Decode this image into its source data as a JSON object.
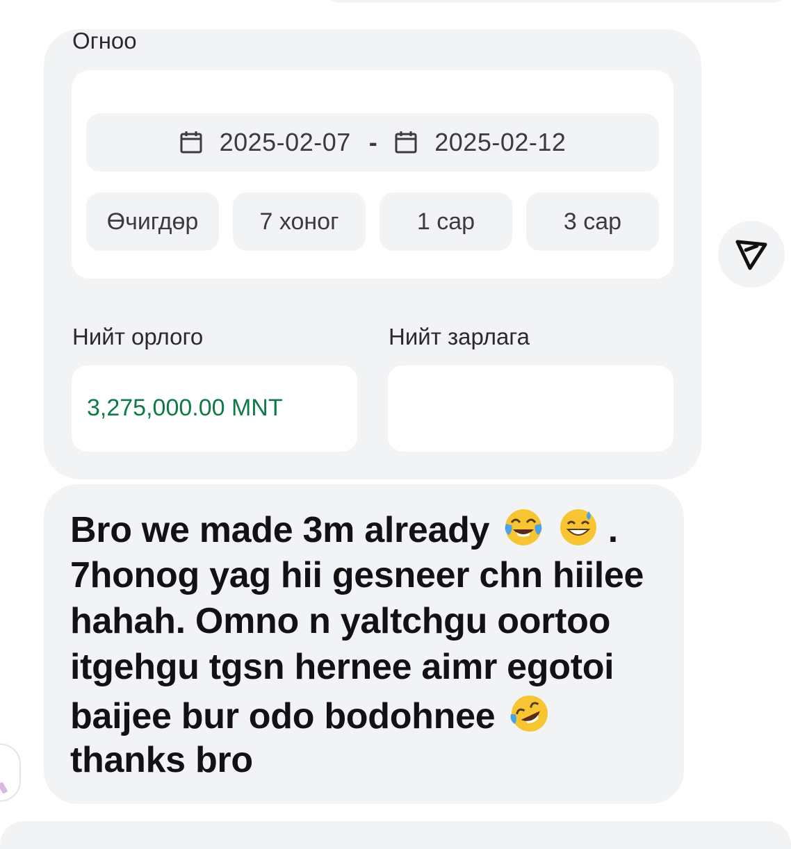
{
  "date_filter": {
    "section_label": "Огноо",
    "start_date": "2025-02-07",
    "separator": "-",
    "end_date": "2025-02-12",
    "presets": [
      "Өчигдөр",
      "7 хоног",
      "1 сар",
      "3 сар"
    ]
  },
  "stats": {
    "income_label": "Нийт орлого",
    "income_value": "3,275,000.00 MNT",
    "expense_label": "Нийт зарлага",
    "expense_value": ""
  },
  "message": {
    "lines": [
      "Bro we made 3m already",
      "7honog yag hii gesneer chn hiilee",
      "hahah. Omno n yaltchgu oortoo",
      "itgehgu tgsn hernee aimr egotoi",
      "baijee bur odo bodohnee",
      "thanks bro"
    ],
    "line1_suffix": ".",
    "emojis": [
      "face-with-tears-of-joy",
      "grinning-face-with-sweat",
      "rolling-on-the-floor-laughing"
    ]
  },
  "colors": {
    "income_value": "#0f7a47",
    "card_background": "#f2f3f5"
  },
  "icons": {
    "date_start": "calendar-icon",
    "date_end": "calendar-icon",
    "send": "send-icon"
  }
}
